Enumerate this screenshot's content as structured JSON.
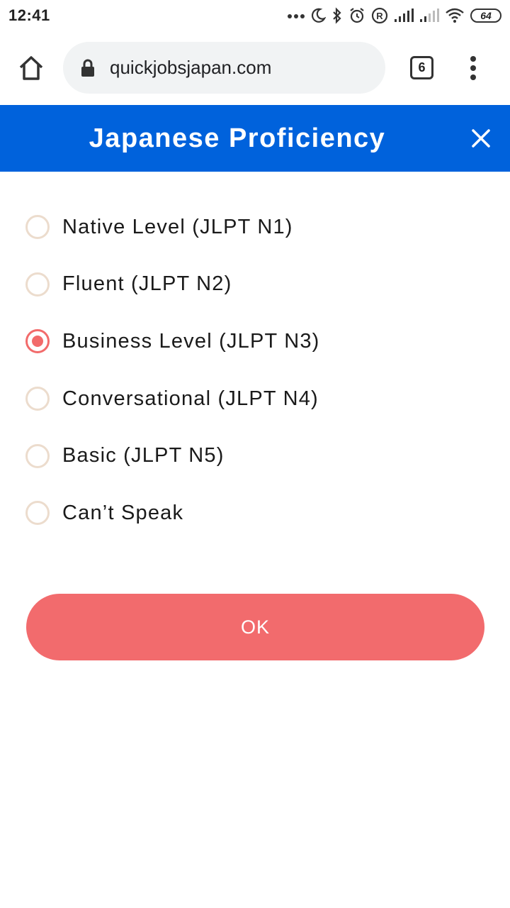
{
  "status_bar": {
    "time": "12:41",
    "battery": "64"
  },
  "browser": {
    "url": "quickjobsjapan.com",
    "tab_count": "6"
  },
  "modal": {
    "title": "Japanese Proficiency",
    "options": [
      {
        "label": "Native Level (JLPT N1)",
        "selected": false
      },
      {
        "label": "Fluent (JLPT N2)",
        "selected": false
      },
      {
        "label": "Business Level (JLPT N3)",
        "selected": true
      },
      {
        "label": "Conversational (JLPT N4)",
        "selected": false
      },
      {
        "label": "Basic (JLPT N5)",
        "selected": false
      },
      {
        "label": "Can’t Speak",
        "selected": false
      }
    ],
    "ok_label": "OK"
  },
  "colors": {
    "header": "#0062dc",
    "accent": "#f26b6d",
    "radio_border": "#ecdccd"
  }
}
